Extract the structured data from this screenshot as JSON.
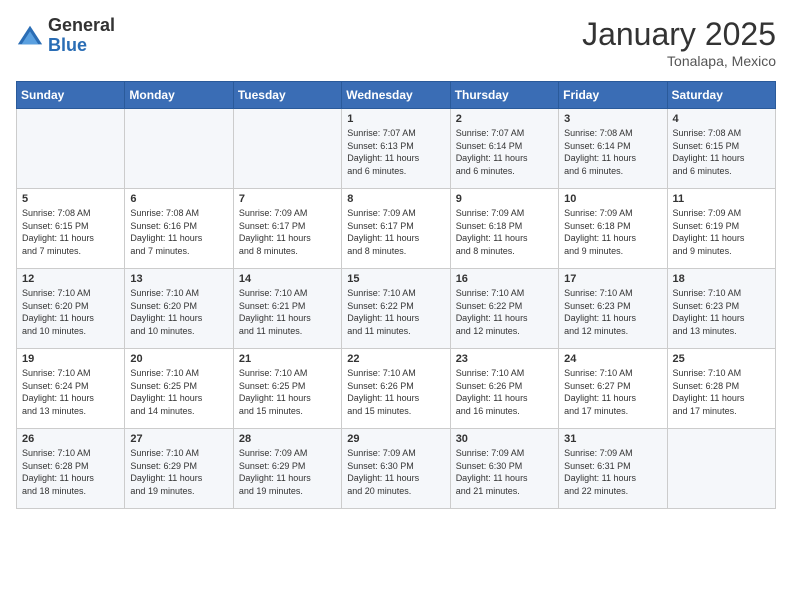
{
  "header": {
    "logo_general": "General",
    "logo_blue": "Blue",
    "calendar_title": "January 2025",
    "calendar_subtitle": "Tonalapa, Mexico"
  },
  "days_of_week": [
    "Sunday",
    "Monday",
    "Tuesday",
    "Wednesday",
    "Thursday",
    "Friday",
    "Saturday"
  ],
  "weeks": [
    [
      {
        "day": "",
        "info": ""
      },
      {
        "day": "",
        "info": ""
      },
      {
        "day": "",
        "info": ""
      },
      {
        "day": "1",
        "info": "Sunrise: 7:07 AM\nSunset: 6:13 PM\nDaylight: 11 hours\nand 6 minutes."
      },
      {
        "day": "2",
        "info": "Sunrise: 7:07 AM\nSunset: 6:14 PM\nDaylight: 11 hours\nand 6 minutes."
      },
      {
        "day": "3",
        "info": "Sunrise: 7:08 AM\nSunset: 6:14 PM\nDaylight: 11 hours\nand 6 minutes."
      },
      {
        "day": "4",
        "info": "Sunrise: 7:08 AM\nSunset: 6:15 PM\nDaylight: 11 hours\nand 6 minutes."
      }
    ],
    [
      {
        "day": "5",
        "info": "Sunrise: 7:08 AM\nSunset: 6:15 PM\nDaylight: 11 hours\nand 7 minutes."
      },
      {
        "day": "6",
        "info": "Sunrise: 7:08 AM\nSunset: 6:16 PM\nDaylight: 11 hours\nand 7 minutes."
      },
      {
        "day": "7",
        "info": "Sunrise: 7:09 AM\nSunset: 6:17 PM\nDaylight: 11 hours\nand 8 minutes."
      },
      {
        "day": "8",
        "info": "Sunrise: 7:09 AM\nSunset: 6:17 PM\nDaylight: 11 hours\nand 8 minutes."
      },
      {
        "day": "9",
        "info": "Sunrise: 7:09 AM\nSunset: 6:18 PM\nDaylight: 11 hours\nand 8 minutes."
      },
      {
        "day": "10",
        "info": "Sunrise: 7:09 AM\nSunset: 6:18 PM\nDaylight: 11 hours\nand 9 minutes."
      },
      {
        "day": "11",
        "info": "Sunrise: 7:09 AM\nSunset: 6:19 PM\nDaylight: 11 hours\nand 9 minutes."
      }
    ],
    [
      {
        "day": "12",
        "info": "Sunrise: 7:10 AM\nSunset: 6:20 PM\nDaylight: 11 hours\nand 10 minutes."
      },
      {
        "day": "13",
        "info": "Sunrise: 7:10 AM\nSunset: 6:20 PM\nDaylight: 11 hours\nand 10 minutes."
      },
      {
        "day": "14",
        "info": "Sunrise: 7:10 AM\nSunset: 6:21 PM\nDaylight: 11 hours\nand 11 minutes."
      },
      {
        "day": "15",
        "info": "Sunrise: 7:10 AM\nSunset: 6:22 PM\nDaylight: 11 hours\nand 11 minutes."
      },
      {
        "day": "16",
        "info": "Sunrise: 7:10 AM\nSunset: 6:22 PM\nDaylight: 11 hours\nand 12 minutes."
      },
      {
        "day": "17",
        "info": "Sunrise: 7:10 AM\nSunset: 6:23 PM\nDaylight: 11 hours\nand 12 minutes."
      },
      {
        "day": "18",
        "info": "Sunrise: 7:10 AM\nSunset: 6:23 PM\nDaylight: 11 hours\nand 13 minutes."
      }
    ],
    [
      {
        "day": "19",
        "info": "Sunrise: 7:10 AM\nSunset: 6:24 PM\nDaylight: 11 hours\nand 13 minutes."
      },
      {
        "day": "20",
        "info": "Sunrise: 7:10 AM\nSunset: 6:25 PM\nDaylight: 11 hours\nand 14 minutes."
      },
      {
        "day": "21",
        "info": "Sunrise: 7:10 AM\nSunset: 6:25 PM\nDaylight: 11 hours\nand 15 minutes."
      },
      {
        "day": "22",
        "info": "Sunrise: 7:10 AM\nSunset: 6:26 PM\nDaylight: 11 hours\nand 15 minutes."
      },
      {
        "day": "23",
        "info": "Sunrise: 7:10 AM\nSunset: 6:26 PM\nDaylight: 11 hours\nand 16 minutes."
      },
      {
        "day": "24",
        "info": "Sunrise: 7:10 AM\nSunset: 6:27 PM\nDaylight: 11 hours\nand 17 minutes."
      },
      {
        "day": "25",
        "info": "Sunrise: 7:10 AM\nSunset: 6:28 PM\nDaylight: 11 hours\nand 17 minutes."
      }
    ],
    [
      {
        "day": "26",
        "info": "Sunrise: 7:10 AM\nSunset: 6:28 PM\nDaylight: 11 hours\nand 18 minutes."
      },
      {
        "day": "27",
        "info": "Sunrise: 7:10 AM\nSunset: 6:29 PM\nDaylight: 11 hours\nand 19 minutes."
      },
      {
        "day": "28",
        "info": "Sunrise: 7:09 AM\nSunset: 6:29 PM\nDaylight: 11 hours\nand 19 minutes."
      },
      {
        "day": "29",
        "info": "Sunrise: 7:09 AM\nSunset: 6:30 PM\nDaylight: 11 hours\nand 20 minutes."
      },
      {
        "day": "30",
        "info": "Sunrise: 7:09 AM\nSunset: 6:30 PM\nDaylight: 11 hours\nand 21 minutes."
      },
      {
        "day": "31",
        "info": "Sunrise: 7:09 AM\nSunset: 6:31 PM\nDaylight: 11 hours\nand 22 minutes."
      },
      {
        "day": "",
        "info": ""
      }
    ]
  ]
}
